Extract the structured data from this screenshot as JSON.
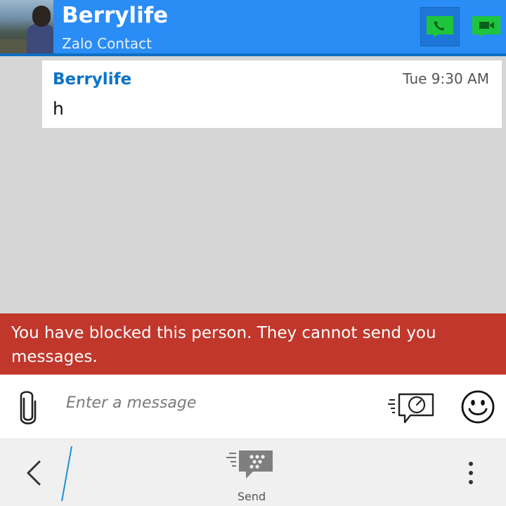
{
  "header": {
    "contact_name": "Berrylife",
    "subtitle": "Zalo Contact",
    "call_icon": "phone-icon",
    "video_icon": "video-call-icon",
    "accent_color": "#2a8cf5",
    "icon_color": "#1ec53c"
  },
  "conversation": {
    "messages": [
      {
        "sender": "Berrylife",
        "time": "Tue 9:30 AM",
        "text": "h"
      }
    ]
  },
  "banner": {
    "text": "You have blocked this person. They cannot send you messages.",
    "color": "#c1372b"
  },
  "composer": {
    "placeholder": "Enter a message",
    "attach_icon": "paperclip-icon",
    "timed_icon": "timed-message-icon",
    "emoji_icon": "smiley-icon"
  },
  "action_bar": {
    "back_icon": "back-chevron-icon",
    "send_label": "Send",
    "send_icon": "bbm-send-icon",
    "more_icon": "overflow-menu-icon"
  }
}
